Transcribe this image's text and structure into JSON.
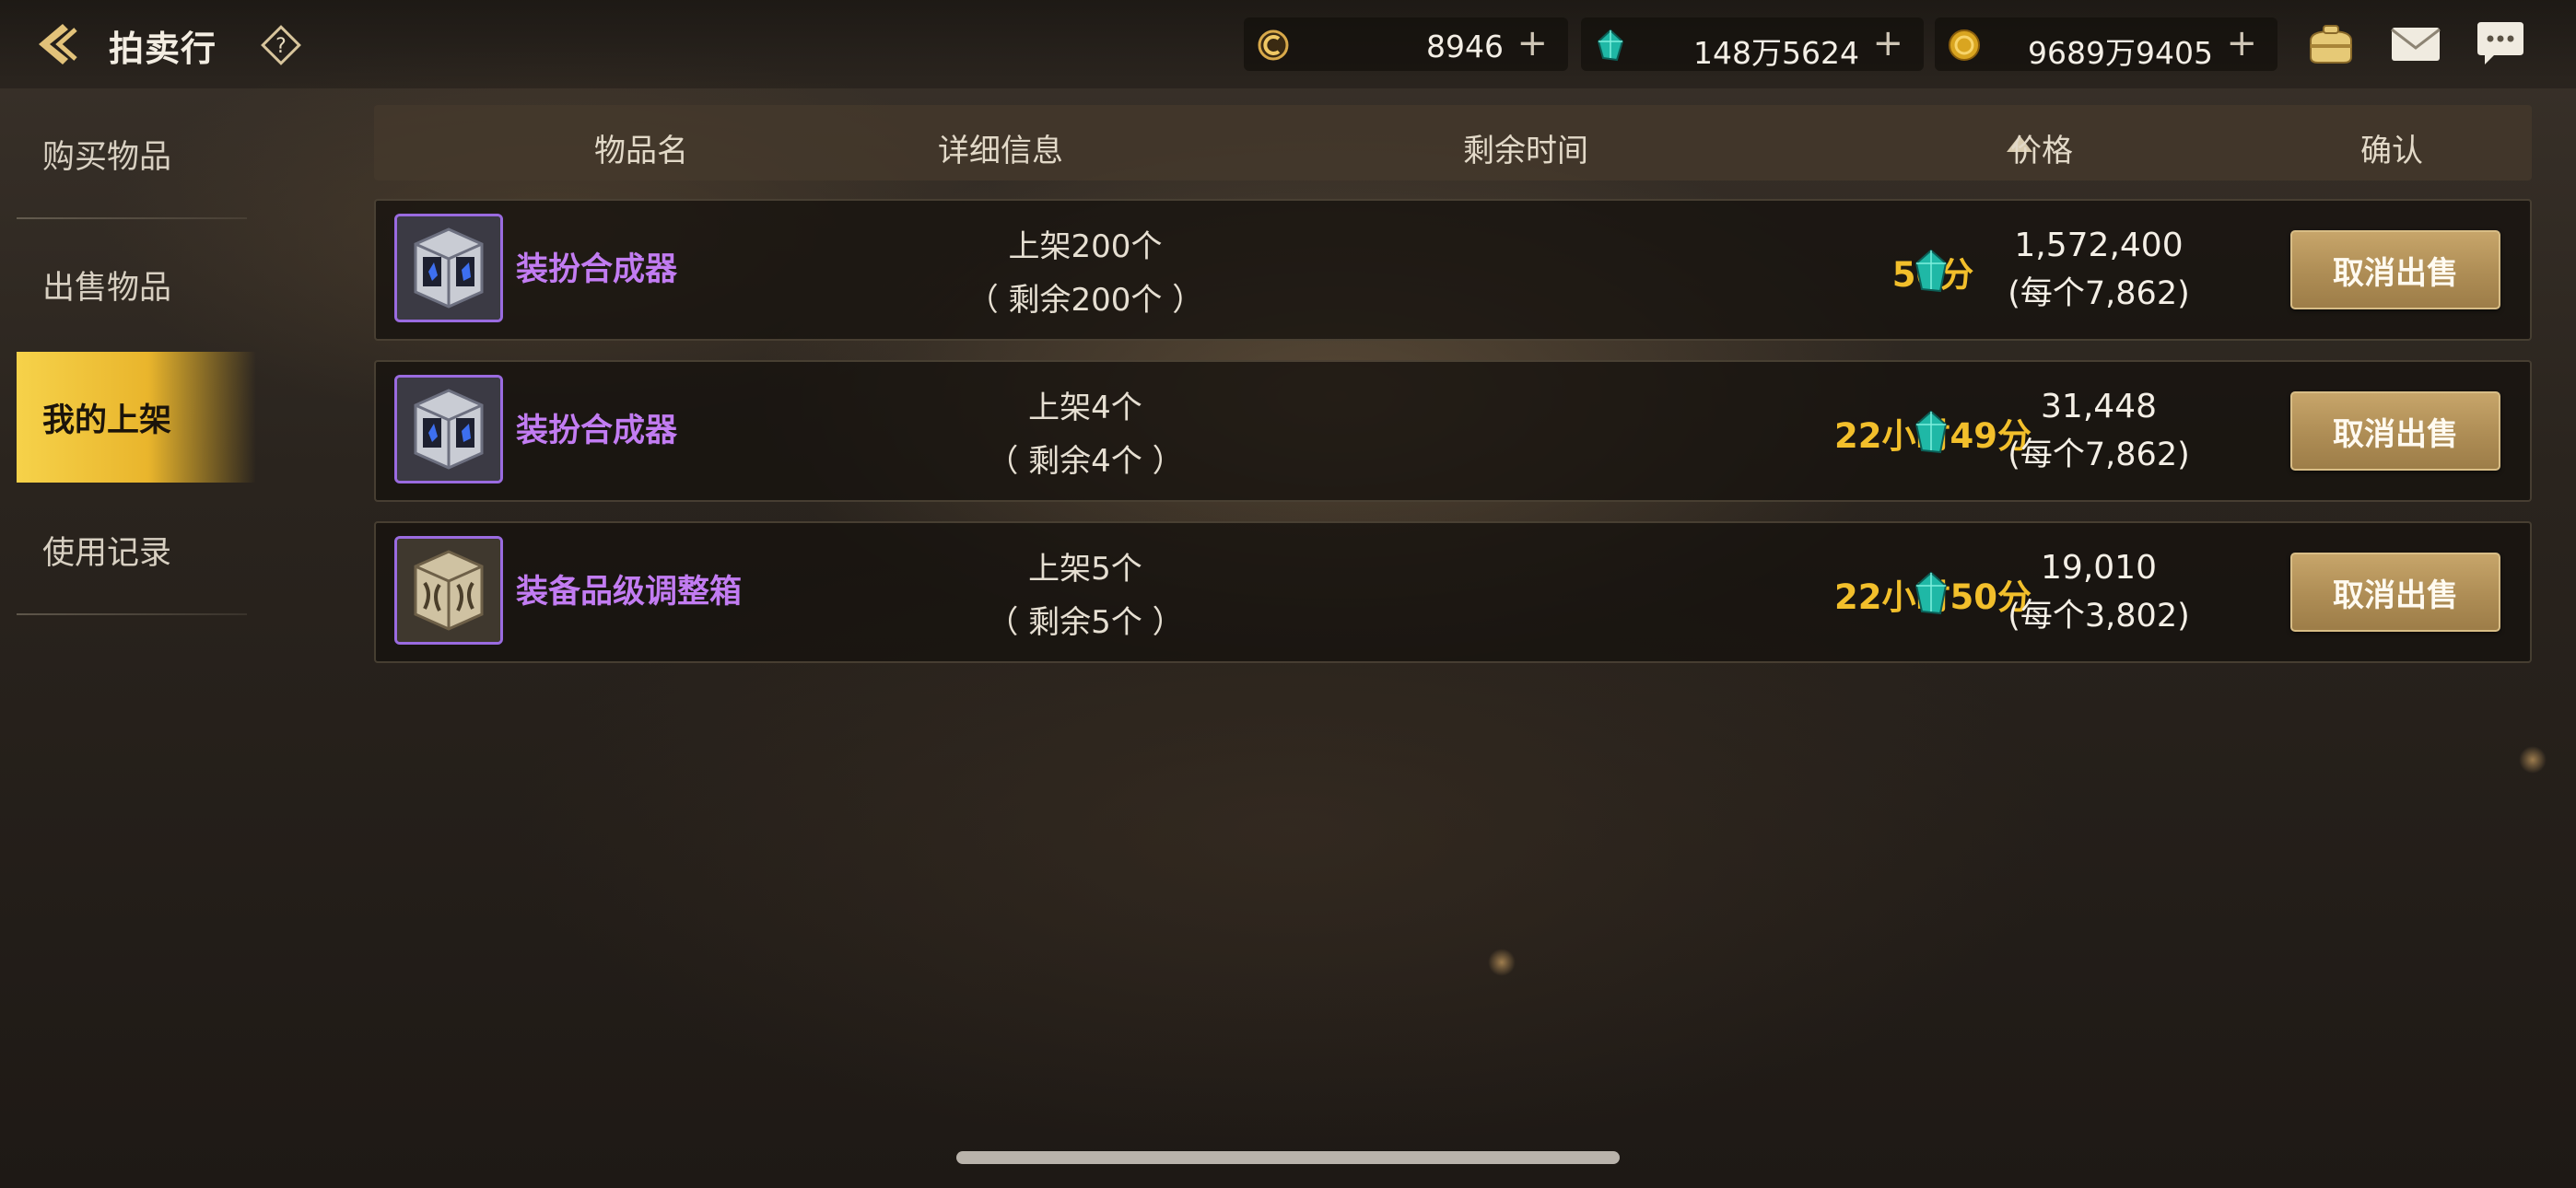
{
  "header": {
    "title": "拍卖行"
  },
  "currencies": [
    {
      "icon": "coin-c-icon",
      "value": "8946",
      "plus": "+"
    },
    {
      "icon": "teal-gem-icon",
      "value": "148万5624",
      "plus": "+"
    },
    {
      "icon": "gold-coin-icon",
      "value": "9689万9405",
      "plus": "+"
    }
  ],
  "top_icons": [
    "purse-icon",
    "mail-icon",
    "chat-icon"
  ],
  "sidebar": {
    "items": [
      {
        "label": "购买物品",
        "active": false
      },
      {
        "label": "出售物品",
        "active": false
      },
      {
        "label": "我的上架",
        "active": true
      },
      {
        "label": "使用记录",
        "active": false
      }
    ]
  },
  "table": {
    "columns": [
      "物品名",
      "详细信息",
      "剩余时间",
      "价格",
      "确认"
    ],
    "rows": [
      {
        "icon": "costume-synthesizer-icon",
        "name": "装扮合成器",
        "detail_line1": "上架200个",
        "detail_line2": "（ 剩余200个 ）",
        "time": "50分",
        "price": "1,572,400",
        "price_each": "(每个7,862)",
        "action": "取消出售"
      },
      {
        "icon": "costume-synthesizer-icon",
        "name": "装扮合成器",
        "detail_line1": "上架4个",
        "detail_line2": "（ 剩余4个 ）",
        "time": "22小时49分",
        "price": "31,448",
        "price_each": "(每个7,862)",
        "action": "取消出售"
      },
      {
        "icon": "equipment-grade-box-icon",
        "name": "装备品级调整箱",
        "detail_line1": "上架5个",
        "detail_line2": "（ 剩余5个 ）",
        "time": "22小时50分",
        "price": "19,010",
        "price_each": "(每个3,802)",
        "action": "取消出售"
      }
    ]
  },
  "colors": {
    "item_name": "#c27cf2",
    "time": "#f2bf2b",
    "active_tab": "#f6d24a",
    "button": "#ae8d55"
  }
}
